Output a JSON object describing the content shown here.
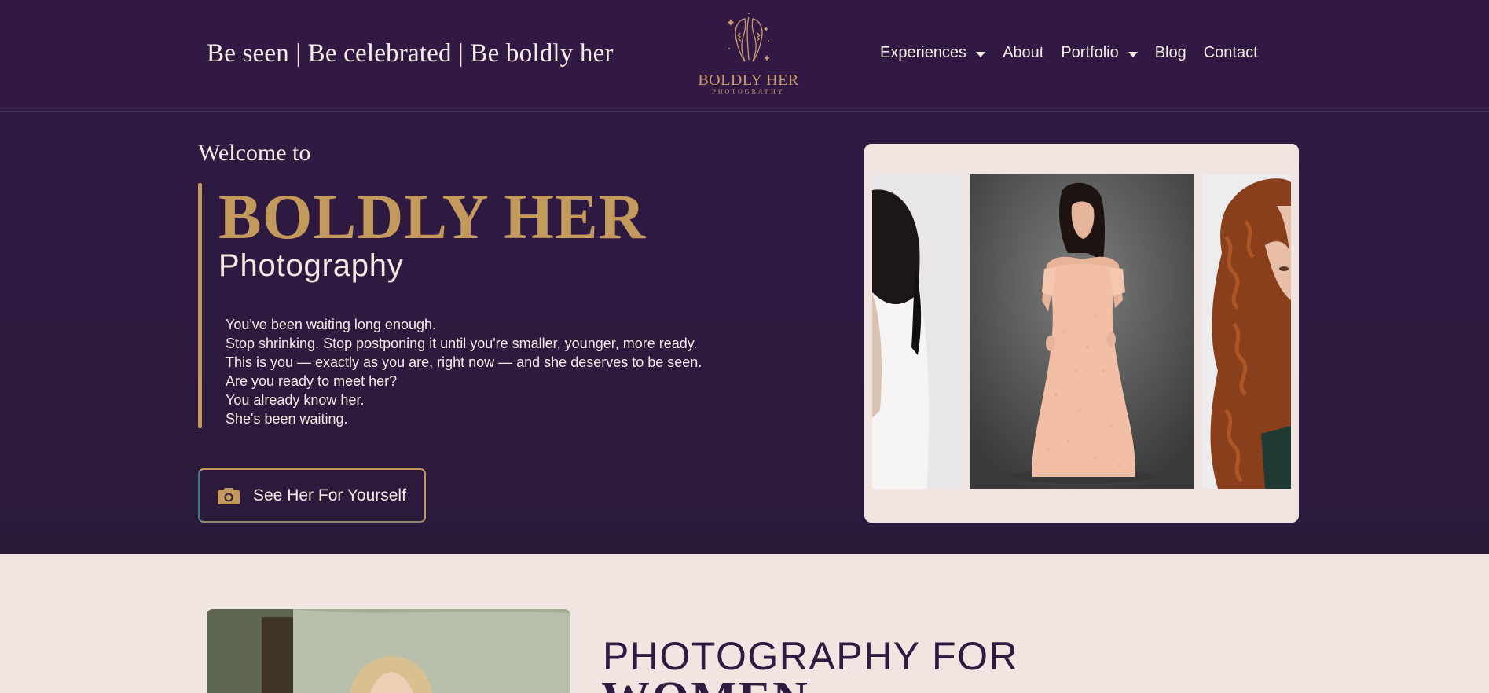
{
  "header": {
    "tagline": "Be seen | Be celebrated | Be boldly her",
    "logo_title": "BOLDLY HER",
    "logo_subtitle": "PHOTOGRAPHY",
    "nav": [
      {
        "label": "Experiences",
        "has_dropdown": true
      },
      {
        "label": "About",
        "has_dropdown": false
      },
      {
        "label": "Portfolio",
        "has_dropdown": true
      },
      {
        "label": "Blog",
        "has_dropdown": false
      },
      {
        "label": "Contact",
        "has_dropdown": false
      }
    ]
  },
  "hero": {
    "welcome": "Welcome to",
    "brand_title": "BOLDLY HER",
    "brand_subtitle": "Photography",
    "intro_lines": [
      "You've been waiting long enough.",
      "Stop shrinking. Stop postponing it until you're smaller, younger, more ready.",
      "This is you — exactly as you are, right now — and she deserves to be seen.",
      "Are you ready to meet her?",
      "You already know her.",
      "She's been waiting."
    ],
    "cta_label": "See Her For Yourself",
    "cta_icon": "camera-icon"
  },
  "lower": {
    "heading_line1": "PHOTOGRAPHY FOR",
    "heading_line2": "WOMEN"
  },
  "colors": {
    "background": "#2f1a42",
    "accent_gold": "#c49a5c",
    "light": "#f0e5e0",
    "text_light": "#f4e9e3"
  }
}
